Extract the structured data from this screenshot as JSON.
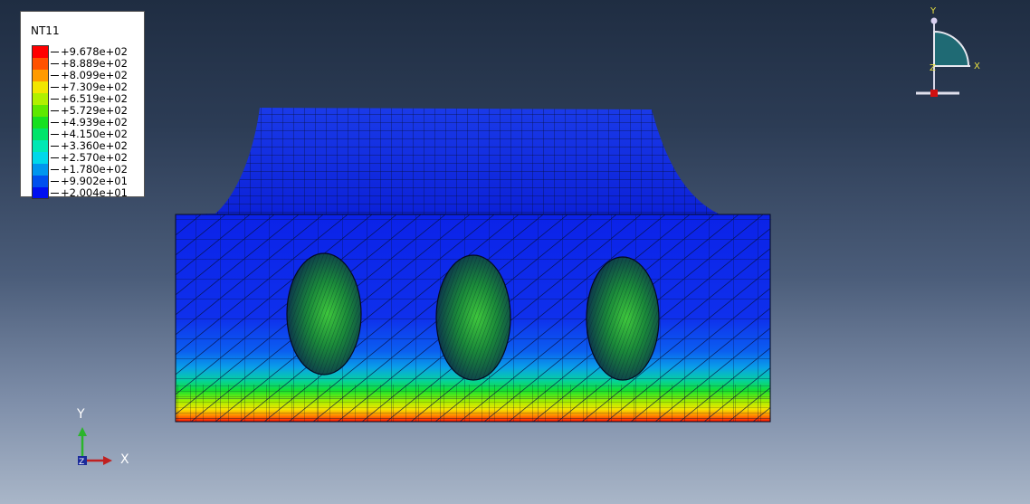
{
  "colors": {
    "background_top": "#1f2d42",
    "background_bottom": "#a9b6c8",
    "mesh_line": "#0a1030",
    "axis_y": "#2bb52b",
    "axis_x": "#c02020",
    "triad_label": "#e8e040"
  },
  "legend": {
    "title": "NT11",
    "entries": [
      {
        "value": "+9.678e+02",
        "color": "#ff0000"
      },
      {
        "value": "+8.889e+02",
        "color": "#ff5200"
      },
      {
        "value": "+8.099e+02",
        "color": "#ff9a00"
      },
      {
        "value": "+7.309e+02",
        "color": "#f2e600"
      },
      {
        "value": "+6.519e+02",
        "color": "#b0f000"
      },
      {
        "value": "+5.729e+02",
        "color": "#5ee800"
      },
      {
        "value": "+4.939e+02",
        "color": "#17e020"
      },
      {
        "value": "+4.150e+02",
        "color": "#00e46a"
      },
      {
        "value": "+3.360e+02",
        "color": "#00e8b4"
      },
      {
        "value": "+2.570e+02",
        "color": "#00d8ea"
      },
      {
        "value": "+1.780e+02",
        "color": "#0096ee"
      },
      {
        "value": "+9.902e+01",
        "color": "#0050ee"
      },
      {
        "value": "+2.004e+01",
        "color": "#0010f0"
      }
    ]
  },
  "triad_top_right": {
    "y_label": "Y",
    "x_label": "X",
    "z_label": "Z"
  },
  "triad_bottom_left": {
    "y_label": "Y",
    "x_label": "X",
    "z_label": "Z"
  }
}
